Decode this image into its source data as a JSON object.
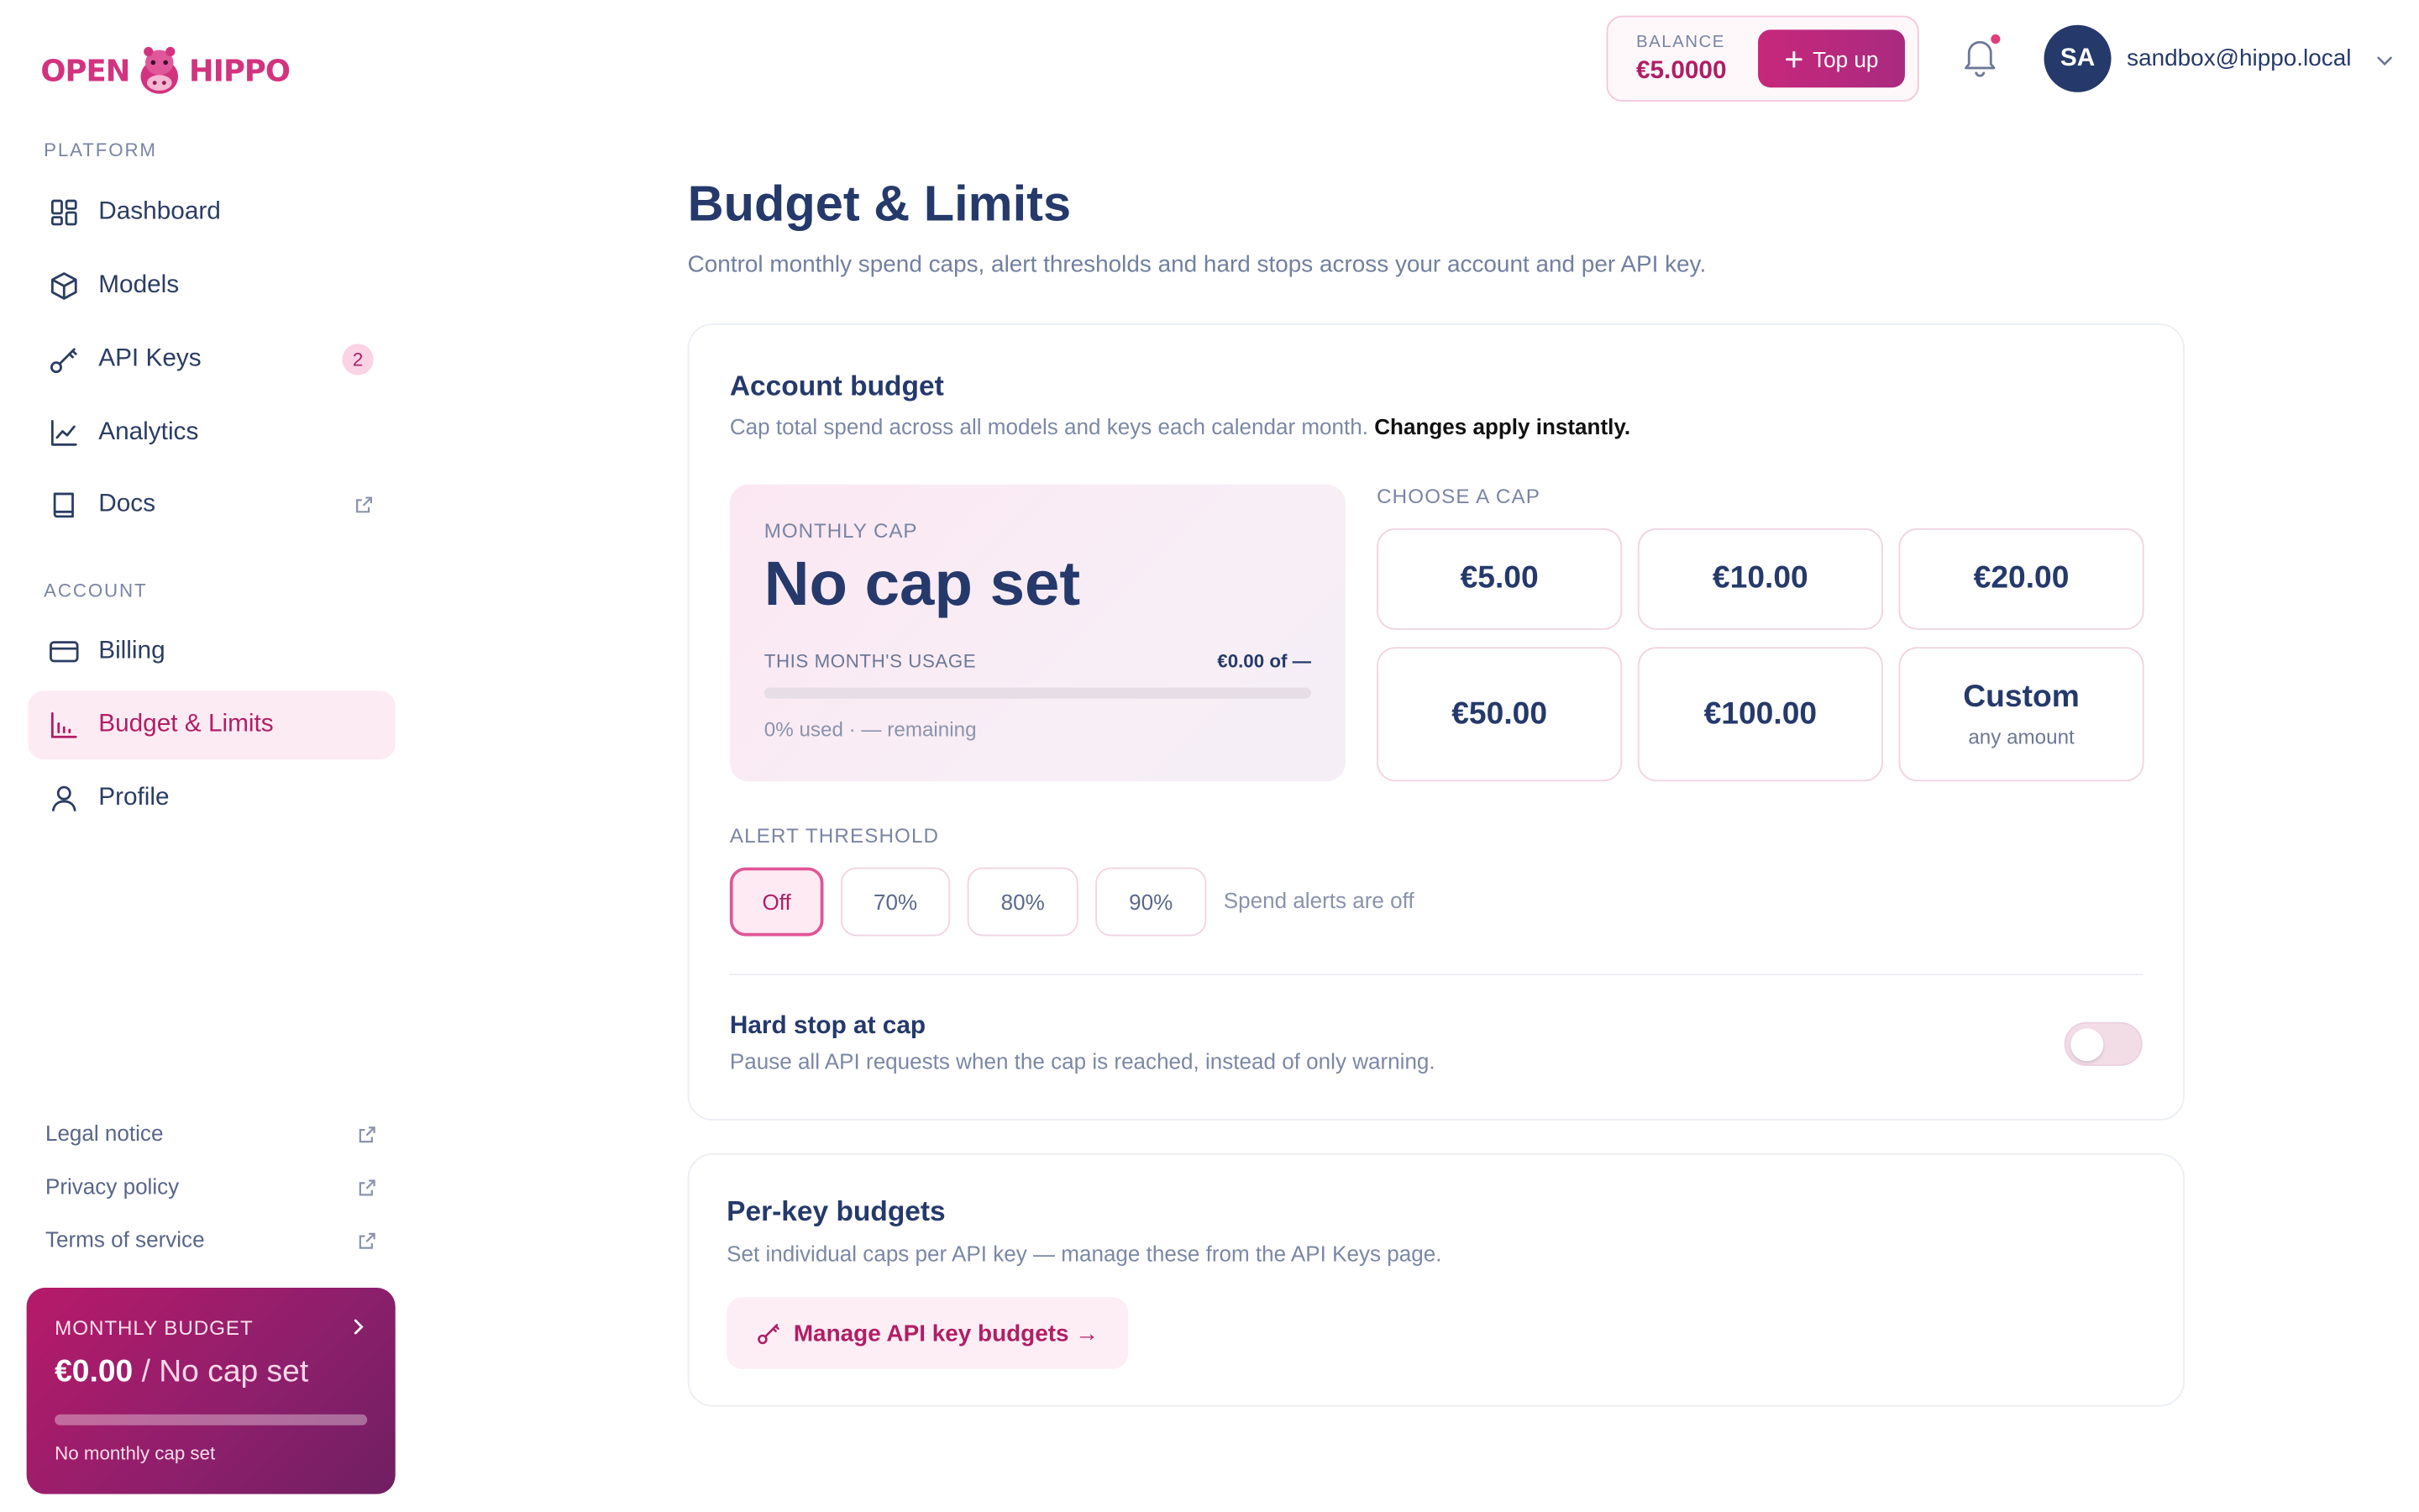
{
  "brand": {
    "logo_left": "OPEN",
    "logo_right": "HIPPO"
  },
  "sidebar": {
    "platform_label": "PLATFORM",
    "platform_items": [
      {
        "label": "Dashboard",
        "icon": "grid-icon"
      },
      {
        "label": "Models",
        "icon": "cube-icon"
      },
      {
        "label": "API Keys",
        "icon": "key-icon",
        "badge": "2"
      },
      {
        "label": "Analytics",
        "icon": "chart-line-icon"
      },
      {
        "label": "Docs",
        "icon": "book-icon",
        "external": true
      }
    ],
    "account_label": "ACCOUNT",
    "account_items": [
      {
        "label": "Billing",
        "icon": "credit-card-icon"
      },
      {
        "label": "Budget & Limits",
        "icon": "bar-chart-icon",
        "active": true
      },
      {
        "label": "Profile",
        "icon": "user-icon"
      }
    ],
    "footer_links": [
      {
        "label": "Legal notice"
      },
      {
        "label": "Privacy policy"
      },
      {
        "label": "Terms of service"
      }
    ],
    "budget_card": {
      "label": "MONTHLY BUDGET",
      "amount": "€0.00",
      "separator": "/",
      "cap_text": "No cap set",
      "note": "No monthly cap set",
      "usage_fraction": 0
    }
  },
  "topbar": {
    "balance_label": "BALANCE",
    "balance_value": "€5.0000",
    "topup_label": "Top up",
    "avatar_initials": "SA",
    "user_email": "sandbox@hippo.local"
  },
  "page": {
    "title": "Budget & Limits",
    "subtitle": "Control monthly spend caps, alert thresholds and hard stops across your account and per API key."
  },
  "account_budget": {
    "title": "Account budget",
    "subtitle": "Cap total spend across all models and keys each calendar month.",
    "subtitle_bold": "Changes apply instantly.",
    "monthly_cap_label": "MONTHLY CAP",
    "monthly_cap_value": "No cap set",
    "usage_label": "THIS MONTH'S USAGE",
    "usage_value": "€0.00 of —",
    "usage_fraction": 0,
    "usage_note": "0% used · — remaining",
    "choose_label": "CHOOSE A CAP",
    "cap_options": [
      {
        "label": "€5.00"
      },
      {
        "label": "€10.00"
      },
      {
        "label": "€20.00"
      },
      {
        "label": "€50.00"
      },
      {
        "label": "€100.00"
      },
      {
        "label": "Custom",
        "sub": "any amount"
      }
    ],
    "alert_label": "ALERT THRESHOLD",
    "alert_options": [
      "Off",
      "70%",
      "80%",
      "90%"
    ],
    "alert_selected": "Off",
    "alert_status": "Spend alerts are off",
    "hard_stop_title": "Hard stop at cap",
    "hard_stop_sub": "Pause all API requests when the cap is reached, instead of only warning.",
    "hard_stop_enabled": false
  },
  "per_key": {
    "title": "Per-key budgets",
    "subtitle": "Set individual caps per API key — manage these from the API Keys page.",
    "button_label": "Manage API key budgets →"
  },
  "colors": {
    "accent": "#b01e65",
    "navy": "#25396b",
    "soft_pink": "#fdebf3"
  }
}
